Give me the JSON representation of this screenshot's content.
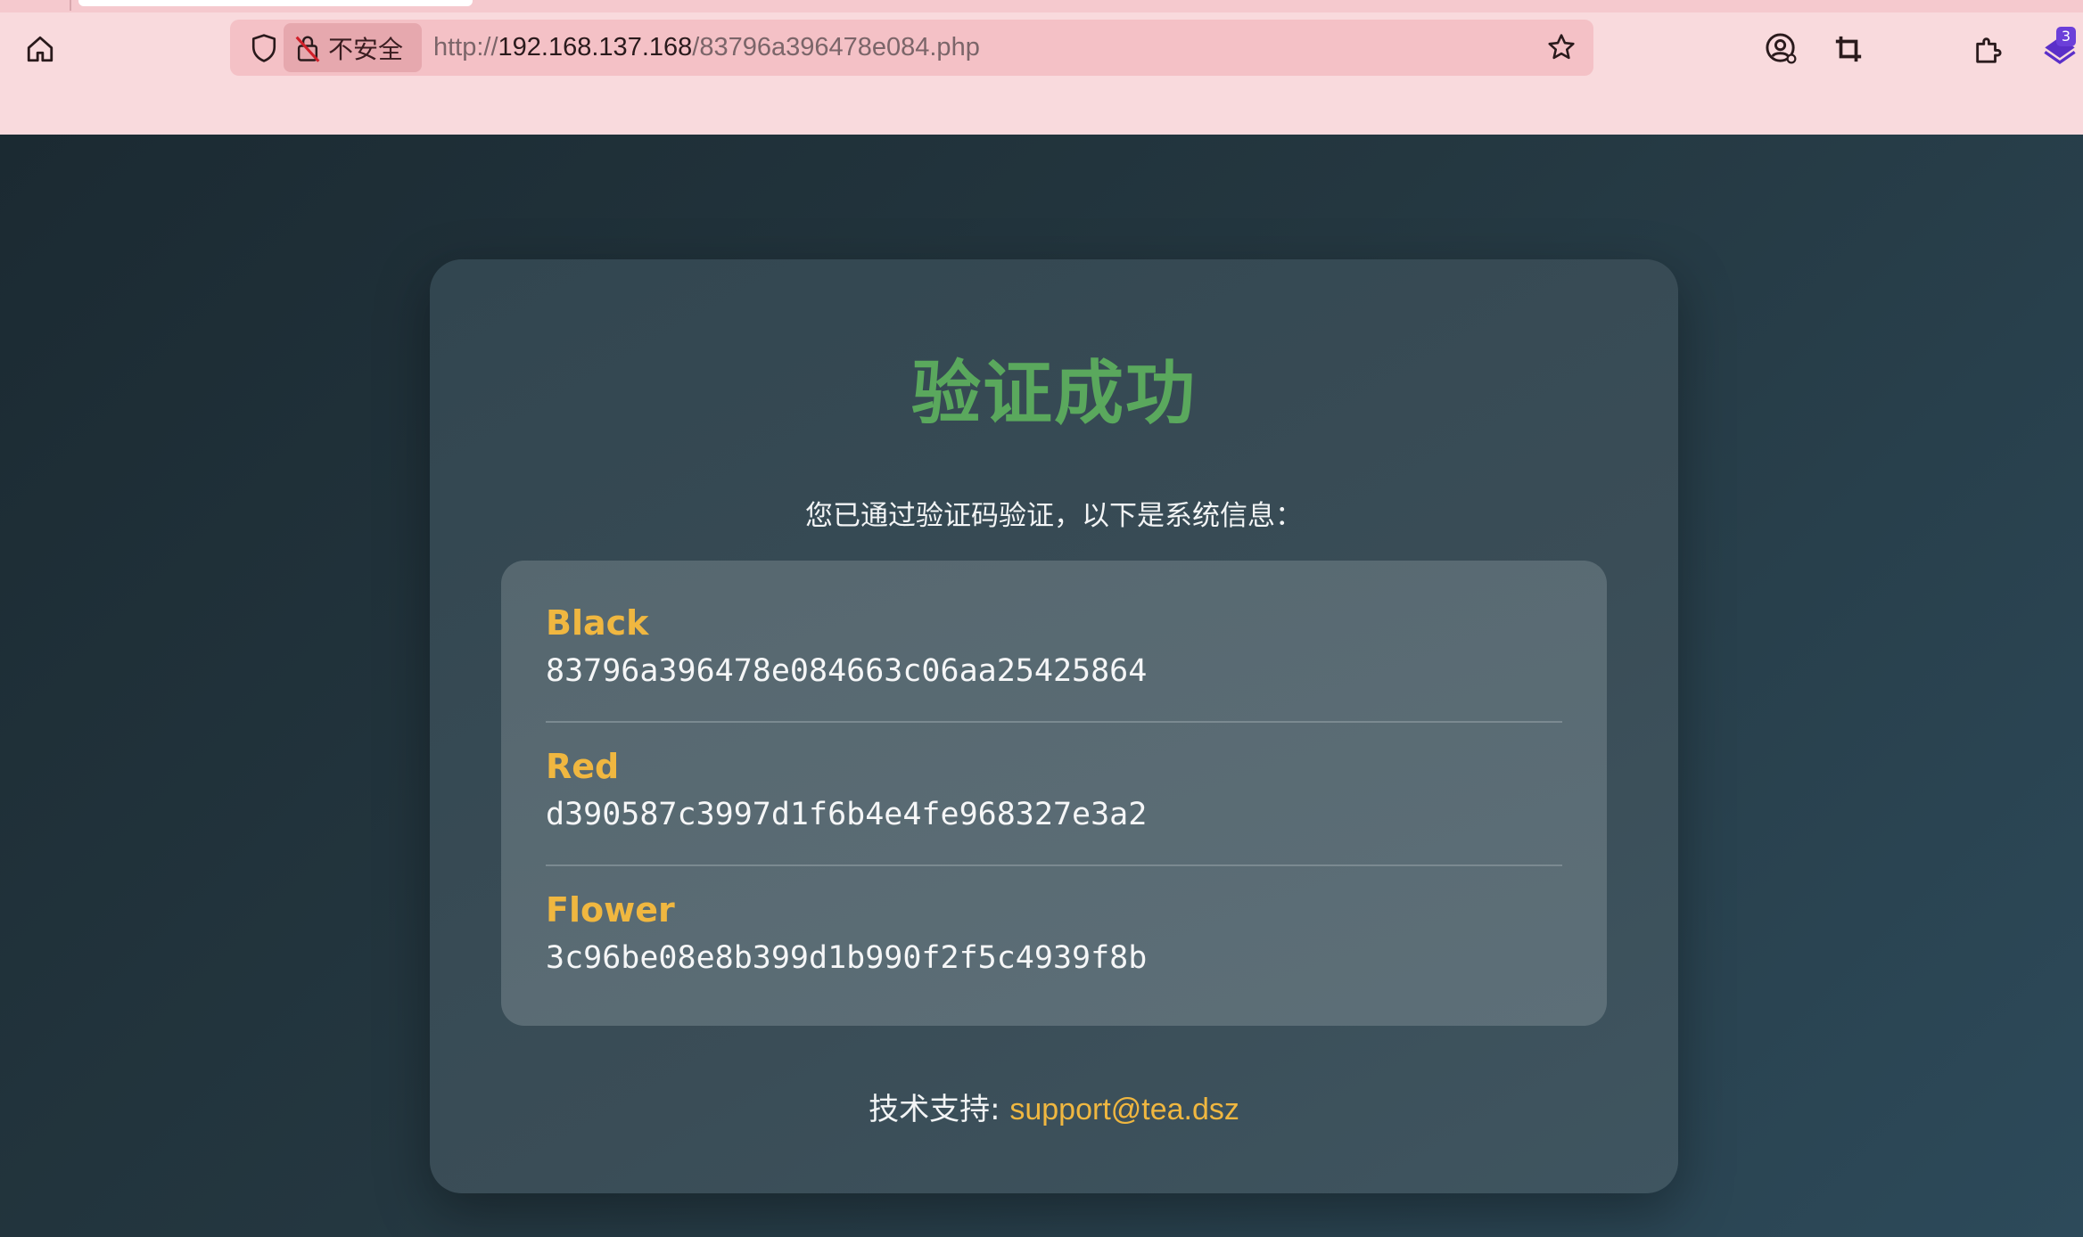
{
  "browser": {
    "security_label": "不安全",
    "url": {
      "scheme": "http://",
      "host": "192.168.137.168",
      "path": "/83796a396478e084.php"
    },
    "extension_badge": "3",
    "icons": {
      "home": "home-icon",
      "shield": "shield-icon",
      "insecure_lock": "insecure-lock-icon",
      "bookmark": "star-icon",
      "account": "account-icon",
      "crop": "crop-icon",
      "extensions": "puzzle-icon",
      "extension_app": "extension-app-icon"
    },
    "colors": {
      "chrome_bg": "#f9dadd",
      "urlbar_bg": "#f4c1c6"
    }
  },
  "page": {
    "title": "验证成功",
    "subtitle": "您已通过验证码验证，以下是系统信息：",
    "items": [
      {
        "name": "Black",
        "value": "83796a396478e084663c06aa25425864"
      },
      {
        "name": "Red",
        "value": "d390587c3997d1f6b4e4fe968327e3a2"
      },
      {
        "name": "Flower",
        "value": "3c96be08e8b399d1b990f2f5c4939f8b"
      }
    ],
    "support_label": "技术支持: ",
    "support_email": "support@tea.dsz",
    "colors": {
      "title": "#5aa85d",
      "accent": "#f0b740",
      "card_bg": "#3a4d57",
      "box_bg": "#5a6b74"
    }
  }
}
